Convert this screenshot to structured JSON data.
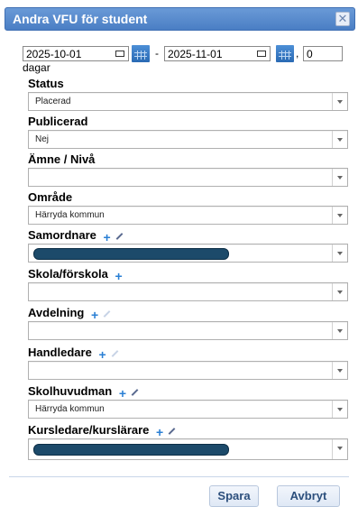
{
  "dialog": {
    "title": "Andra VFU för student",
    "close_icon": "close-icon"
  },
  "period": {
    "start_date": "2025-10-01",
    "separator": "-",
    "end_date": "2025-11-01",
    "days_value": "0",
    "days_prefix": ",",
    "days_label": "dagar"
  },
  "fields": {
    "status": {
      "label": "Status",
      "value": "Placerad"
    },
    "publicerad": {
      "label": "Publicerad",
      "value": "Nej"
    },
    "amne": {
      "label": "Ämne / Nivå",
      "value": ""
    },
    "omrade": {
      "label": "Område",
      "value": "Härryda kommun"
    },
    "samordnare": {
      "label": "Samordnare",
      "value": ""
    },
    "skola": {
      "label": "Skola/förskola",
      "value": ""
    },
    "avdelning": {
      "label": "Avdelning",
      "value": ""
    },
    "handledare": {
      "label": "Handledare",
      "value": ""
    },
    "skolhuvudman": {
      "label": "Skolhuvudman",
      "value": "Härryda kommun"
    },
    "kursledare": {
      "label": "Kursledare/kurslärare",
      "value": ""
    }
  },
  "buttons": {
    "save": "Spara",
    "cancel": "Avbryt"
  }
}
